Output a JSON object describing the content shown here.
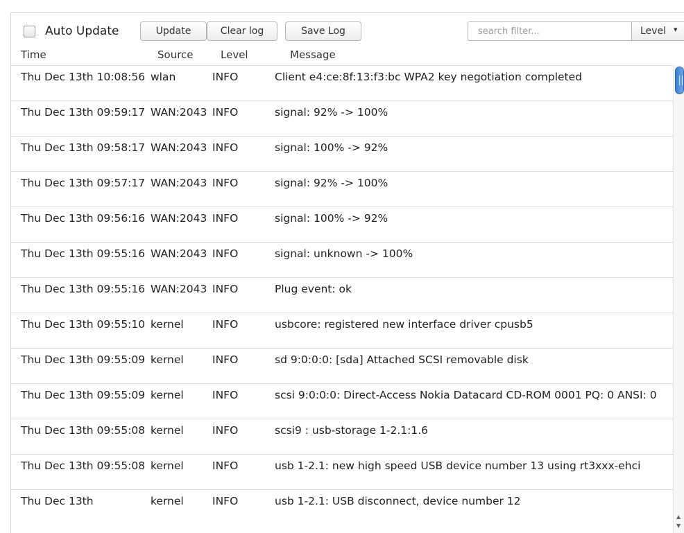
{
  "toolbar": {
    "auto_update_label": "Auto Update",
    "update_label": "Update",
    "clear_log_label": "Clear log",
    "save_log_label": "Save Log",
    "search_placeholder": "search filter...",
    "level_label": "Level"
  },
  "columns": {
    "time": "Time",
    "source": "Source",
    "level": "Level",
    "message": "Message"
  },
  "rows": [
    {
      "time": "Thu Dec 13th 10:08:56",
      "source": "wlan",
      "level": "INFO",
      "message": "Client e4:ce:8f:13:f3:bc WPA2 key negotiation completed"
    },
    {
      "time": "Thu Dec 13th 09:59:17",
      "source": "WAN:2043",
      "level": "INFO",
      "message": "signal: 92% -> 100%"
    },
    {
      "time": "Thu Dec 13th 09:58:17",
      "source": "WAN:2043",
      "level": "INFO",
      "message": "signal: 100% -> 92%"
    },
    {
      "time": "Thu Dec 13th 09:57:17",
      "source": "WAN:2043",
      "level": "INFO",
      "message": "signal: 92% -> 100%"
    },
    {
      "time": "Thu Dec 13th 09:56:16",
      "source": "WAN:2043",
      "level": "INFO",
      "message": "signal: 100% -> 92%"
    },
    {
      "time": "Thu Dec 13th 09:55:16",
      "source": "WAN:2043",
      "level": "INFO",
      "message": "signal: unknown -> 100%"
    },
    {
      "time": "Thu Dec 13th 09:55:16",
      "source": "WAN:2043",
      "level": "INFO",
      "message": "Plug event: ok"
    },
    {
      "time": "Thu Dec 13th 09:55:10",
      "source": "kernel",
      "level": "INFO",
      "message": "usbcore: registered new interface driver cpusb5"
    },
    {
      "time": "Thu Dec 13th 09:55:09",
      "source": "kernel",
      "level": "INFO",
      "message": "sd 9:0:0:0: [sda] Attached SCSI removable disk"
    },
    {
      "time": "Thu Dec 13th 09:55:09",
      "source": "kernel",
      "level": "INFO",
      "message": "scsi 9:0:0:0: Direct-Access Nokia Datacard CD-ROM 0001 PQ: 0 ANSI: 0"
    },
    {
      "time": "Thu Dec 13th 09:55:08",
      "source": "kernel",
      "level": "INFO",
      "message": "scsi9 : usb-storage 1-2.1:1.6"
    },
    {
      "time": "Thu Dec 13th 09:55:08",
      "source": "kernel",
      "level": "INFO",
      "message": "usb 1-2.1: new high speed USB device number 13 using rt3xxx-ehci"
    },
    {
      "time": "Thu Dec 13th",
      "source": "kernel",
      "level": "INFO",
      "message": "usb 1-2.1: USB disconnect, device number 12"
    }
  ],
  "colors": {
    "scroll_thumb": "#3a7fd0",
    "row_divider": "#dedede"
  }
}
